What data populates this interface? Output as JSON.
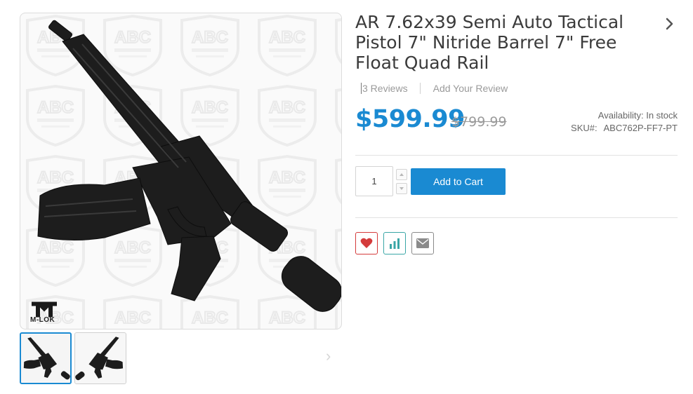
{
  "product": {
    "title": "AR 7.62x39 Semi Auto Tactical Pistol 7\" Nitride Barrel 7\" Free Float Quad Rail",
    "reviews_label": "3 Reviews",
    "add_review_label": "Add Your Review",
    "price": "$599.99",
    "old_price": "$799.99",
    "availability_label": "Availability:",
    "availability_value": "In stock",
    "sku_label": "SKU#:",
    "sku_value": "ABC762P-FF7-PT"
  },
  "gallery": {
    "watermark_text": "ABC",
    "logo_text": "M-LOK",
    "thumbnails": [
      "thumb-1",
      "thumb-2"
    ]
  },
  "cart": {
    "quantity": "1",
    "add_to_cart_label": "Add to Cart"
  },
  "actions": {
    "icons": [
      "heart-icon",
      "bar-chart-icon",
      "envelope-icon"
    ]
  },
  "colors": {
    "accent": "#1a8ad2",
    "wishlist": "#d43b3b",
    "compare": "#3aa6a6",
    "email": "#8a8a8a"
  }
}
